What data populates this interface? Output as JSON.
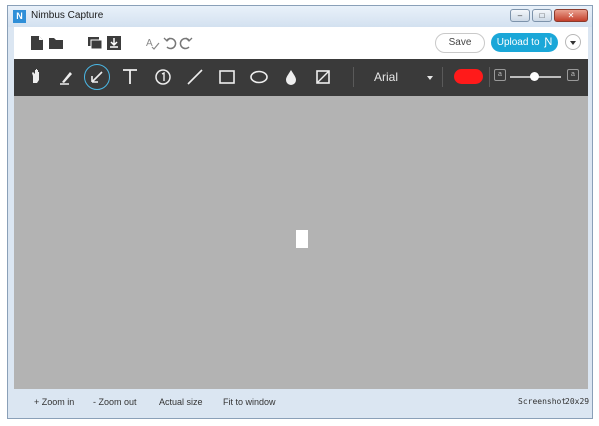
{
  "window": {
    "title": "Nimbus Capture",
    "icon_letter": "N",
    "controls": [
      "minimize",
      "maximize",
      "close"
    ]
  },
  "topbar": {
    "file_icons": [
      "new-file-icon",
      "open-folder-icon",
      "copy-icon",
      "download-icon",
      "spellcheck-icon",
      "undo-icon",
      "redo-icon"
    ],
    "save_label": "Save",
    "upload_label": "Upload to",
    "upload_icon": "nimbus-n-icon",
    "more_icon": "dropdown-arrow-icon"
  },
  "toolbar": {
    "tools": [
      "hand",
      "marker",
      "arrow",
      "text",
      "number",
      "line",
      "rectangle",
      "ellipse",
      "blur",
      "crop"
    ],
    "active_tool": "arrow",
    "font": "Arial",
    "color": "#ff1a1a",
    "size_small_label": "a",
    "size_large_label": "a"
  },
  "canvas": {
    "background": "#b3b3b3"
  },
  "statusbar": {
    "zoom_in": "+ Zoom in",
    "zoom_out": "- Zoom out",
    "actual_size": "Actual size",
    "fit_to_window": "Fit to window",
    "info_label": "Screenshot",
    "info_dims": "20x29"
  }
}
